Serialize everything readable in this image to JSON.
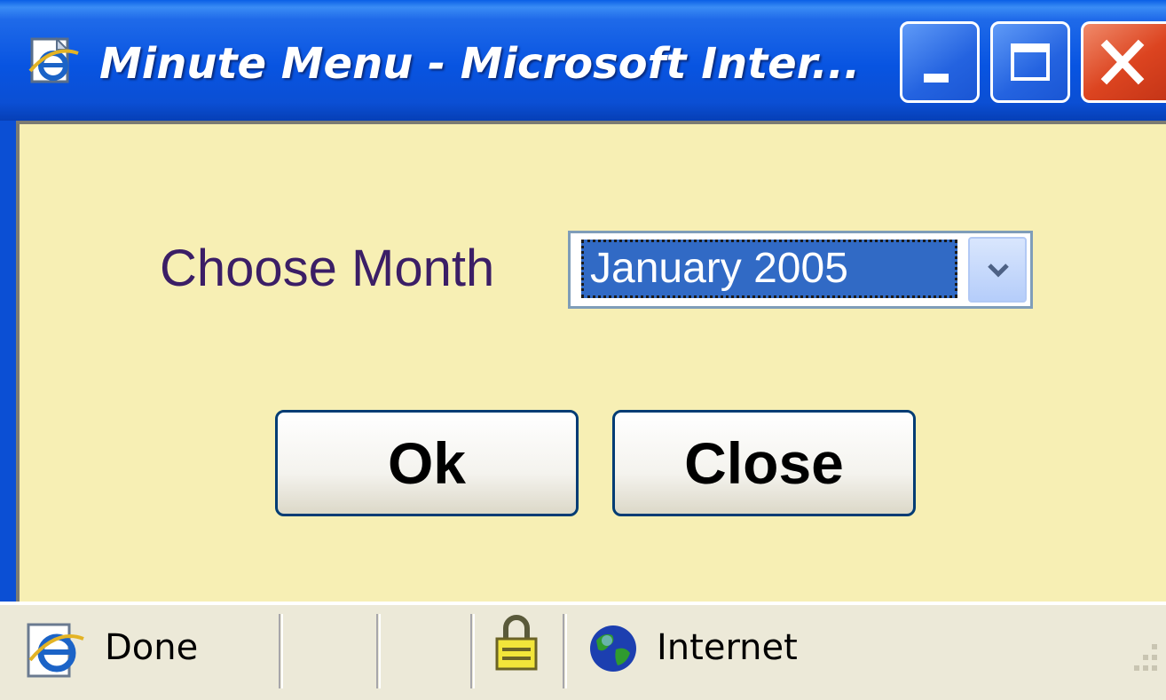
{
  "window": {
    "title": "Minute Menu - Microsoft Inter...",
    "controls": {
      "minimize": "minimize",
      "maximize": "maximize",
      "close": "close"
    }
  },
  "form": {
    "choose_label": "Choose Month",
    "month_select": {
      "selected": "January 2005"
    },
    "ok_label": "Ok",
    "close_label": "Close"
  },
  "statusbar": {
    "status": "Done",
    "zone": "Internet"
  },
  "colors": {
    "titlebar": "#0854e1",
    "content_bg": "#f7efb4",
    "label_color": "#3b1e66",
    "selection": "#316ac5",
    "close_button": "#dc4420"
  },
  "icons": [
    "ie-page-icon",
    "minimize-icon",
    "maximize-icon",
    "close-icon",
    "chevron-down-icon",
    "ie-icon",
    "lock-icon",
    "globe-icon",
    "resize-grip-icon"
  ]
}
